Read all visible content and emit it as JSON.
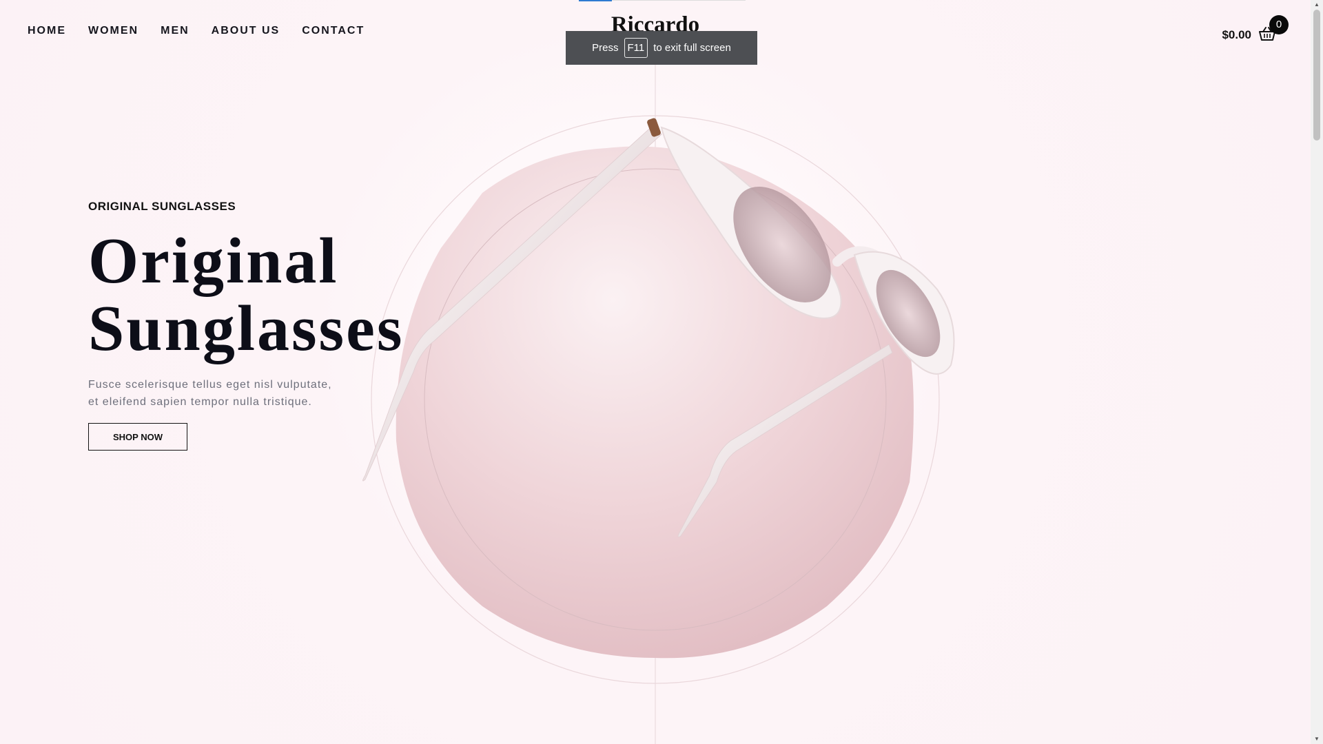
{
  "header": {
    "nav": [
      {
        "label": "HOME"
      },
      {
        "label": "WOMEN"
      },
      {
        "label": "MEN"
      },
      {
        "label": "ABOUT US"
      },
      {
        "label": "CONTACT"
      }
    ],
    "logo": "Riccardo",
    "cart_total": "$0.00",
    "cart_count": "0",
    "cart_icon": "basket-icon"
  },
  "toast": {
    "prefix": "Press",
    "key": "F11",
    "suffix": "to exit full screen"
  },
  "hero": {
    "eyebrow": "ORIGINAL SUNGLASSES",
    "title_line1": "Original",
    "title_line2": "Sunglasses",
    "desc_line1": "Fusce scelerisque tellus eget nisl vulputate,",
    "desc_line2": "et eleifend sapien tempor nulla tristique.",
    "button": "SHOP NOW"
  },
  "colors": {
    "background": "#fcf2f6",
    "accent_pink": "#e9c9cd",
    "text_dark": "#0d0e18"
  }
}
